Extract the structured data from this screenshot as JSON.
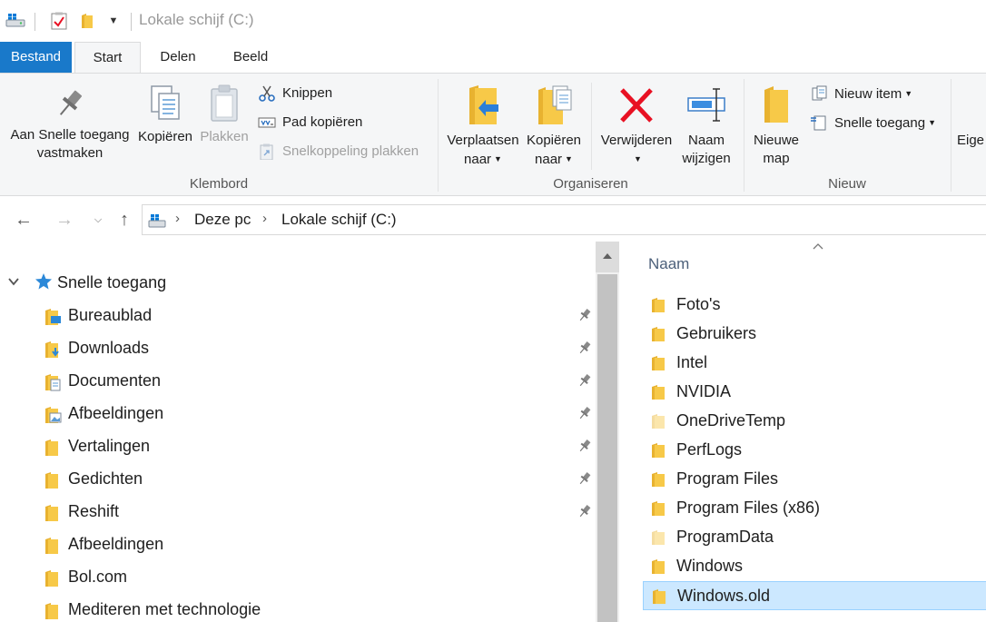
{
  "window": {
    "title": "Lokale schijf (C:)",
    "qat_dropdown_icon": "chevron-down-icon"
  },
  "ribbon_tabs": [
    "Bestand",
    "Start",
    "Delen",
    "Beeld"
  ],
  "ribbon": {
    "clipboard": {
      "label": "Klembord",
      "pin_quick_access": [
        "Aan Snelle toegang",
        "vastmaken"
      ],
      "copy": "Kopiëren",
      "paste": "Plakken",
      "cut": "Knippen",
      "copy_path": "Pad kopiëren",
      "paste_shortcut": "Snelkoppeling plakken"
    },
    "organize": {
      "label": "Organiseren",
      "move_to": [
        "Verplaatsen",
        "naar"
      ],
      "copy_to": [
        "Kopiëren",
        "naar"
      ],
      "delete": "Verwijderen",
      "rename": [
        "Naam",
        "wijzigen"
      ]
    },
    "new": {
      "label": "Nieuw",
      "new_folder": [
        "Nieuwe",
        "map"
      ],
      "new_item": "Nieuw item",
      "easy_access": "Snelle toegang"
    },
    "open": {
      "properties_partial": "Eige"
    }
  },
  "address_bar": {
    "crumbs": [
      "Deze pc",
      "Lokale schijf (C:)"
    ]
  },
  "nav_pane": {
    "root": "Snelle toegang",
    "items": [
      {
        "label": "Bureaublad",
        "icon": "desktop-folder-icon",
        "pinned": true
      },
      {
        "label": "Downloads",
        "icon": "downloads-folder-icon",
        "pinned": true
      },
      {
        "label": "Documenten",
        "icon": "documents-folder-icon",
        "pinned": true
      },
      {
        "label": "Afbeeldingen",
        "icon": "pictures-folder-icon",
        "pinned": true
      },
      {
        "label": "Vertalingen",
        "icon": "folder-icon",
        "pinned": true
      },
      {
        "label": "Gedichten",
        "icon": "folder-icon",
        "pinned": true
      },
      {
        "label": "Reshift",
        "icon": "folder-icon",
        "pinned": true
      },
      {
        "label": "Afbeeldingen",
        "icon": "folder-icon",
        "pinned": false
      },
      {
        "label": "Bol.com",
        "icon": "folder-icon",
        "pinned": false
      },
      {
        "label": "Mediteren met technologie",
        "icon": "folder-icon",
        "pinned": false
      }
    ]
  },
  "content": {
    "column_header": "Naam",
    "sort": "ascending",
    "files": [
      {
        "name": "Foto's",
        "hidden": false,
        "selected": false
      },
      {
        "name": "Gebruikers",
        "hidden": false,
        "selected": false
      },
      {
        "name": "Intel",
        "hidden": false,
        "selected": false
      },
      {
        "name": "NVIDIA",
        "hidden": false,
        "selected": false
      },
      {
        "name": "OneDriveTemp",
        "hidden": true,
        "selected": false
      },
      {
        "name": "PerfLogs",
        "hidden": false,
        "selected": false
      },
      {
        "name": "Program Files",
        "hidden": false,
        "selected": false
      },
      {
        "name": "Program Files (x86)",
        "hidden": false,
        "selected": false
      },
      {
        "name": "ProgramData",
        "hidden": true,
        "selected": false
      },
      {
        "name": "Windows",
        "hidden": false,
        "selected": false
      },
      {
        "name": "Windows.old",
        "hidden": false,
        "selected": true
      }
    ]
  },
  "colors": {
    "file_tab": "#1979ca",
    "selection": "#cce8ff",
    "folder": "#f7c948",
    "delete_red": "#e81123",
    "header_text": "#4c607a"
  }
}
